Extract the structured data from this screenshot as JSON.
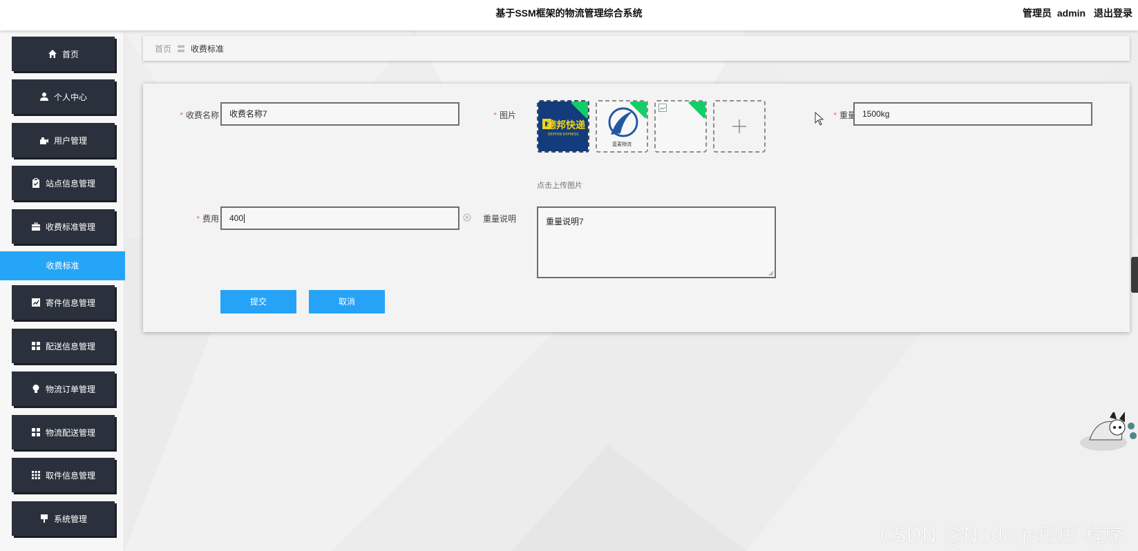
{
  "header": {
    "title": "基于SSM框架的物流管理综合系统",
    "role": "管理员",
    "username": "admin",
    "logout_label": "退出登录"
  },
  "sidebar": {
    "items": [
      {
        "label": "首页",
        "icon": "home-icon"
      },
      {
        "label": "个人中心",
        "icon": "person-icon"
      },
      {
        "label": "用户管理",
        "icon": "user-manage-icon"
      },
      {
        "label": "站点信息管理",
        "icon": "clipboard-icon"
      },
      {
        "label": "收费标准管理",
        "icon": "briefcase-icon"
      },
      {
        "label": "寄件信息管理",
        "icon": "chart-icon"
      },
      {
        "label": "配送信息管理",
        "icon": "grid-icon"
      },
      {
        "label": "物流订单管理",
        "icon": "lightbulb-icon"
      },
      {
        "label": "物流配送管理",
        "icon": "grid-icon"
      },
      {
        "label": "取件信息管理",
        "icon": "table-icon"
      },
      {
        "label": "系统管理",
        "icon": "pin-icon"
      }
    ],
    "active_subitem": "收费标准"
  },
  "breadcrumb": {
    "home": "首页",
    "separator": "〓",
    "current": "收费标准"
  },
  "form": {
    "name_label": "收费名称",
    "name_value": "收费名称7",
    "image_label": "图片",
    "image_hint": "点击上传图片",
    "images": [
      {
        "alt": "德邦快递",
        "sub": "DEPPON EXPRESS"
      },
      {
        "alt": "蓝麦物流"
      },
      {
        "alt": ""
      }
    ],
    "weight_label": "重量",
    "weight_value": "1500kg",
    "fee_label": "费用",
    "fee_value": "400",
    "desc_label": "重量说明",
    "desc_value": "重量说明7",
    "submit_label": "提交",
    "cancel_label": "取消"
  },
  "watermark": "CSDN @Node.js彤彤 程序",
  "colors": {
    "sidebar_item_bg": "#2b313c",
    "active_blue": "#25a5f7",
    "required_red": "#f56c6c",
    "badge_green": "#13ce66"
  }
}
